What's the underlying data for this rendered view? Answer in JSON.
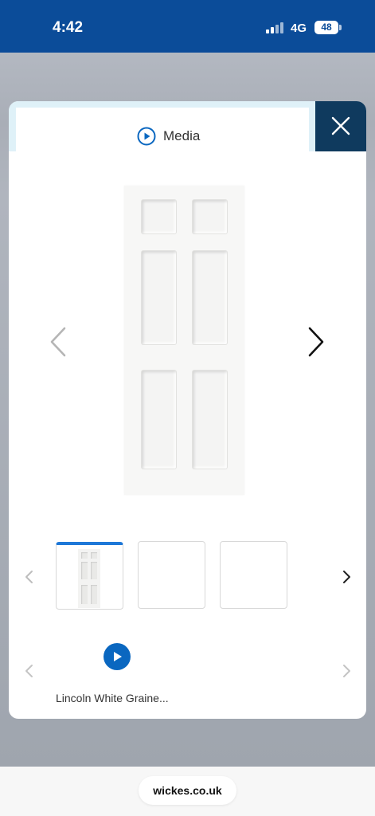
{
  "status_bar": {
    "time": "4:42",
    "network": "4G",
    "battery": "48"
  },
  "modal": {
    "tab_label": "Media",
    "close_icon": "close-icon",
    "prev_icon": "chevron-left-icon",
    "next_icon": "chevron-right-icon",
    "thumbnails": [
      "door-image",
      "empty",
      "empty"
    ],
    "video_caption": "Lincoln White Graine...",
    "accent_color": "#1e78d8"
  },
  "browser": {
    "url": "wickes.co.uk"
  }
}
